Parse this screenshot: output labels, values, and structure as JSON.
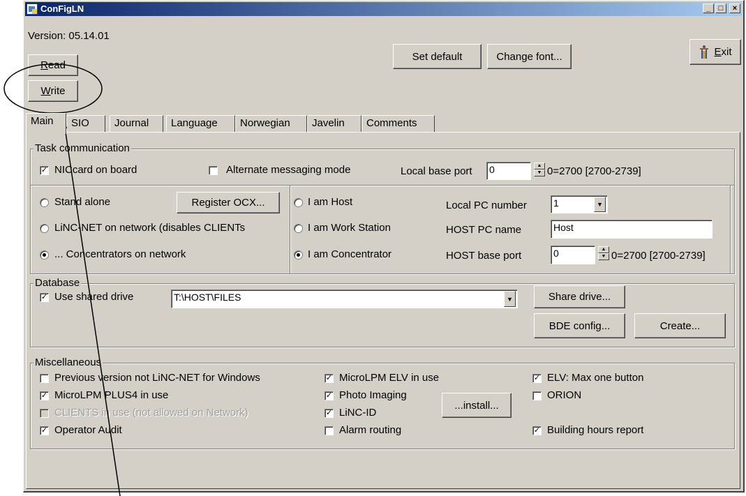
{
  "window": {
    "title": "ConFigLN",
    "minimize": "_",
    "maximize": "□",
    "close": "×"
  },
  "header": {
    "version": "Version: 05.14.01",
    "read_label": "ead",
    "read_mnemonic": "R",
    "write_label": "rite",
    "write_mnemonic": "W",
    "set_default_label": "Set default",
    "change_font_label": "Change font...",
    "exit_label": "xit",
    "exit_mnemonic": "E"
  },
  "tabs": [
    "Main",
    "SIO",
    "Journal",
    "Language",
    "Norwegian",
    "Javelin",
    "Comments"
  ],
  "active_tab": "Main",
  "task_communication": {
    "title": "Task communication",
    "niccard_label": "NICcard on board",
    "niccard_checked": true,
    "alternate_label": "Alternate messaging mode",
    "alternate_checked": false,
    "local_base_port_label": "Local base port",
    "local_base_port_value": "0",
    "local_base_port_hint": "0=2700 [2700-2739]",
    "mode_options": [
      {
        "label": "Stand alone",
        "selected": false
      },
      {
        "label": "LiNC-NET on network (disables CLIENTs",
        "selected": false
      },
      {
        "label": "... Concentrators on network",
        "selected": true
      }
    ],
    "register_ocx_label": "Register OCX...",
    "role_options": [
      {
        "label": "I am Host",
        "selected": false
      },
      {
        "label": "I am Work Station",
        "selected": false
      },
      {
        "label": "I am Concentrator",
        "selected": true
      }
    ],
    "local_pc_number_label": "Local PC number",
    "local_pc_number_value": "1",
    "host_pc_name_label": "HOST PC name",
    "host_pc_name_value": "Host",
    "host_base_port_label": "HOST base port",
    "host_base_port_value": "0",
    "host_base_port_hint": "0=2700 [2700-2739]"
  },
  "database": {
    "title": "Database",
    "use_shared_label": "Use shared drive",
    "use_shared_checked": true,
    "path_value": "T:\\HOST\\FILES",
    "share_drive_label": "Share drive...",
    "bde_config_label": "BDE config...",
    "create_label": "Create..."
  },
  "misc": {
    "title": "Miscellaneous",
    "col1": [
      {
        "label": "Previous version not LiNC-NET for Windows",
        "checked": false,
        "disabled": false
      },
      {
        "label": "MicroLPM PLUS4 in use",
        "checked": true,
        "disabled": false
      },
      {
        "label": "CLIENTS in use (not allowed on Network)",
        "checked": false,
        "disabled": true
      },
      {
        "label": "Operator Audit",
        "checked": true,
        "disabled": false
      }
    ],
    "col2": [
      {
        "label": "MicroLPM ELV in use",
        "checked": true
      },
      {
        "label": "Photo Imaging",
        "checked": true
      },
      {
        "label": "LiNC-ID",
        "checked": true
      },
      {
        "label": "Alarm routing",
        "checked": false
      }
    ],
    "install_label": "...install...",
    "col3": [
      {
        "label": "ELV: Max one button",
        "checked": true
      },
      {
        "label": "ORION",
        "checked": false
      },
      {
        "label": "Building hours report",
        "checked": true
      }
    ]
  },
  "icons": {
    "app": "app-icon",
    "exit": "exit-door-icon",
    "dropdown": "chevron-down-icon",
    "check": "✓"
  }
}
